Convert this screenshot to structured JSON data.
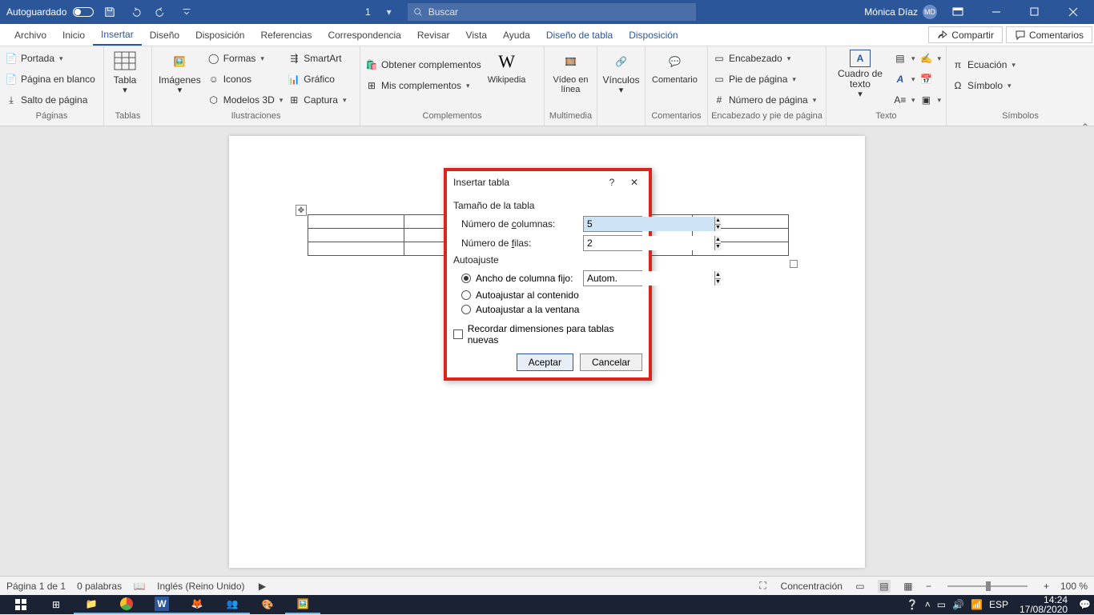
{
  "titlebar": {
    "autosave_label": "Autoguardado",
    "doc_number": "1",
    "search_placeholder": "Buscar",
    "user_name": "Mónica Díaz",
    "user_initials": "MD"
  },
  "menu": {
    "items": [
      "Archivo",
      "Inicio",
      "Insertar",
      "Diseño",
      "Disposición",
      "Referencias",
      "Correspondencia",
      "Revisar",
      "Vista",
      "Ayuda",
      "Diseño de tabla",
      "Disposición"
    ],
    "active_index": 2,
    "share": "Compartir",
    "comments": "Comentarios"
  },
  "ribbon": {
    "pages": {
      "label": "Páginas",
      "cover": "Portada",
      "blank": "Página en blanco",
      "break": "Salto de página"
    },
    "tables": {
      "label": "Tablas",
      "table": "Tabla"
    },
    "illus": {
      "label": "Ilustraciones",
      "images": "Imágenes",
      "shapes": "Formas",
      "icons": "Iconos",
      "models": "Modelos 3D",
      "smartart": "SmartArt",
      "chart": "Gráfico",
      "capture": "Captura"
    },
    "addins": {
      "label": "Complementos",
      "get": "Obtener complementos",
      "my": "Mis complementos",
      "wiki": "Wikipedia"
    },
    "media": {
      "label": "Multimedia",
      "video": "Vídeo en línea"
    },
    "links": {
      "label": "",
      "link": "Vínculos"
    },
    "comments": {
      "label": "Comentarios",
      "comment": "Comentario"
    },
    "headerfooter": {
      "label": "Encabezado y pie de página",
      "header": "Encabezado",
      "footer": "Pie de página",
      "pagenum": "Número de página"
    },
    "text": {
      "label": "Texto",
      "textbox": "Cuadro de texto"
    },
    "symbols": {
      "label": "Símbolos",
      "equation": "Ecuación",
      "symbol": "Símbolo"
    }
  },
  "dialog": {
    "title": "Insertar tabla",
    "size_group": "Tamaño de la tabla",
    "columns_label_pre": "Número de ",
    "columns_label_u": "c",
    "columns_label_post": "olumnas:",
    "columns_value": "5",
    "rows_label_pre": "Número de ",
    "rows_label_u": "f",
    "rows_label_post": "ilas:",
    "rows_value": "2",
    "autofit_group": "Autoajuste",
    "fixed_pre": "Ancho de columna fi",
    "fixed_u": "j",
    "fixed_post": "o:",
    "fixed_value": "Autom.",
    "fit_content_pre": "",
    "fit_content_u": "A",
    "fit_content_post": "utoajustar al contenido",
    "fit_window_pre": "Autoajustar a la ",
    "fit_window_u": "v",
    "fit_window_post": "entana",
    "remember_pre": "",
    "remember_u": "R",
    "remember_post": "ecordar dimensiones para tablas nuevas",
    "ok": "Aceptar",
    "cancel": "Cancelar"
  },
  "status": {
    "page": "Página 1 de 1",
    "words": "0 palabras",
    "lang": "Inglés (Reino Unido)",
    "focus": "Concentración",
    "zoom": "100 %"
  },
  "tray": {
    "lang": "ESP",
    "time": "14:24",
    "date": "17/08/2020"
  }
}
